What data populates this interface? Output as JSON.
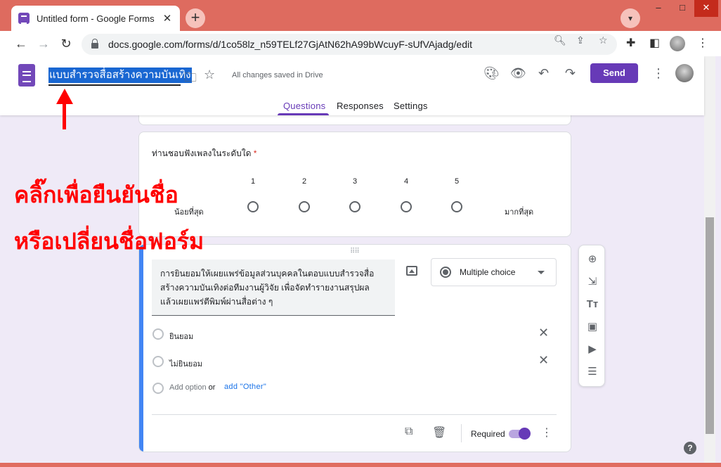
{
  "browser": {
    "tab_title": "Untitled form - Google Forms",
    "tab_close": "✕",
    "new_tab": "+",
    "url": "docs.google.com/forms/d/1co58lz_n59TELf27GjAtN62hA99bWcuyF-sUfVAjadg/edit"
  },
  "header": {
    "form_title": "แบบสำรวจสื่อสร้างความบันเทิง",
    "save_status": "All changes saved in Drive",
    "send_label": "Send"
  },
  "nav_tabs": [
    "Questions",
    "Responses",
    "Settings"
  ],
  "scale_question": {
    "title": "ท่านชอบฟังเพลงในระดับใด",
    "required_mark": "*",
    "numbers": [
      "1",
      "2",
      "3",
      "4",
      "5"
    ],
    "low_label": "น้อยที่สุด",
    "high_label": "มากที่สุด"
  },
  "annotation": {
    "line1": "คลิ๊กเพื่อยืนยันชื่อ",
    "line2": "หรือเปลี่ยนชื่อฟอร์ม"
  },
  "active_question": {
    "text": "การยินยอมให้เผยแพร่ข้อมูลส่วนบุคคลในตอบแบบสำรวจสื่อสร้างความบันเทิงต่อทีมงานผู้วิจัย เพื่อจัดทำรายงานสรุปผล แล้วเผยแพร่ตีพิมพ์ผ่านสื่อต่าง ๆ",
    "type": "Multiple choice",
    "options": [
      "ยินยอม",
      "ไม่ยินยอม"
    ],
    "add_option": "Add option",
    "or": "or",
    "add_other": "add \"Other\"",
    "required_label": "Required",
    "required_on": true
  },
  "colors": {
    "accent": "#673ab7",
    "frame": "#de6b5f",
    "page_bg": "#efeaf7",
    "annotation": "#ff0000"
  }
}
